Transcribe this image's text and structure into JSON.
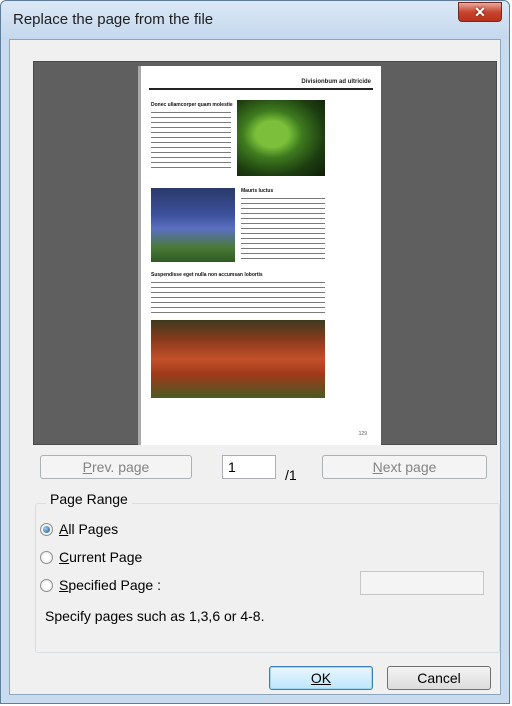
{
  "window": {
    "title": "Replace the page from the file"
  },
  "preview": {
    "header_text": "Divisionbum ad ultricide",
    "heading_1": "Donec ullamcorper quam molestie",
    "heading_2": "Mauris luctus",
    "heading_3": "Suspendisse eget nulla non accumsan lobortis",
    "page_number": "129"
  },
  "nav": {
    "prev_label": "Prev. page",
    "prev_mnemonic": "P",
    "page_input_value": "1",
    "total_pages": "/1",
    "next_label": "Next page",
    "next_mnemonic": "N"
  },
  "range": {
    "legend": "Page Range",
    "options": [
      {
        "label": "All Pages",
        "mnemonic": "A",
        "selected": true
      },
      {
        "label": "Current Page",
        "mnemonic": "C",
        "selected": false
      },
      {
        "label": "Specified Page :",
        "mnemonic": "S",
        "selected": false
      }
    ],
    "specified_value": "",
    "hint": "Specify pages such as 1,3,6 or 4-8."
  },
  "buttons": {
    "ok": "OK",
    "ok_mnemonic": "O",
    "cancel": "Cancel"
  }
}
